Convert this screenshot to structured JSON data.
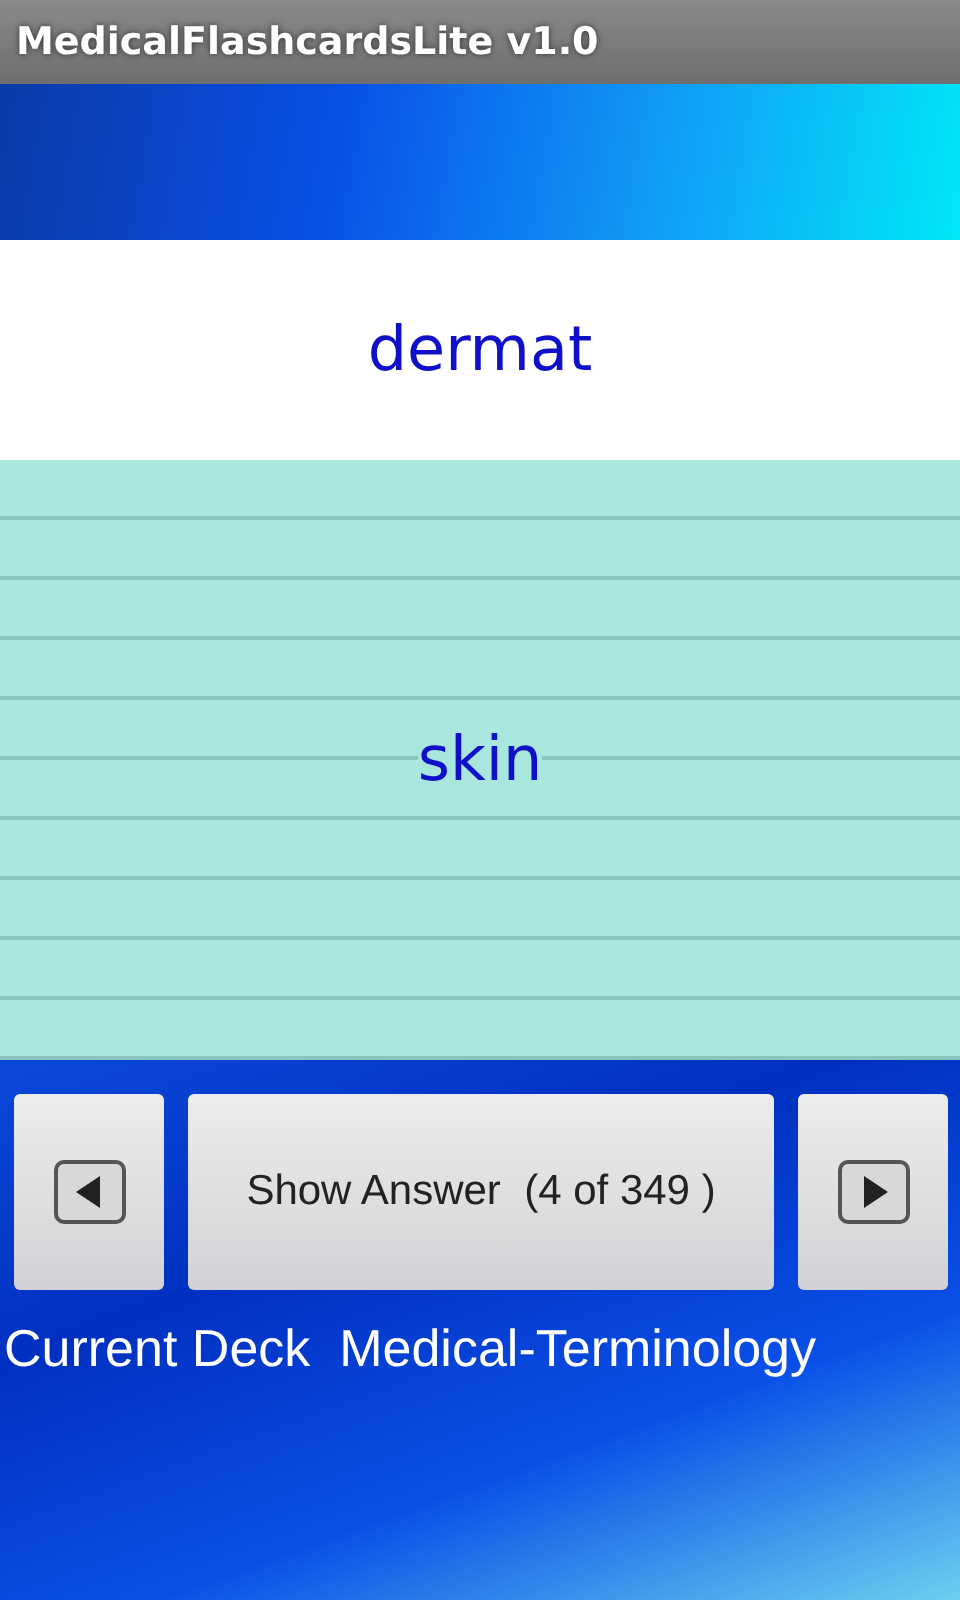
{
  "window": {
    "title": "MedicalFlashcardsLite v1.0"
  },
  "card": {
    "term": "dermat",
    "meaning": "skin"
  },
  "controls": {
    "show_answer": "Show Answer  (4 of 349 )"
  },
  "deck": {
    "text": "Current Deck  Medical-Terminology"
  }
}
